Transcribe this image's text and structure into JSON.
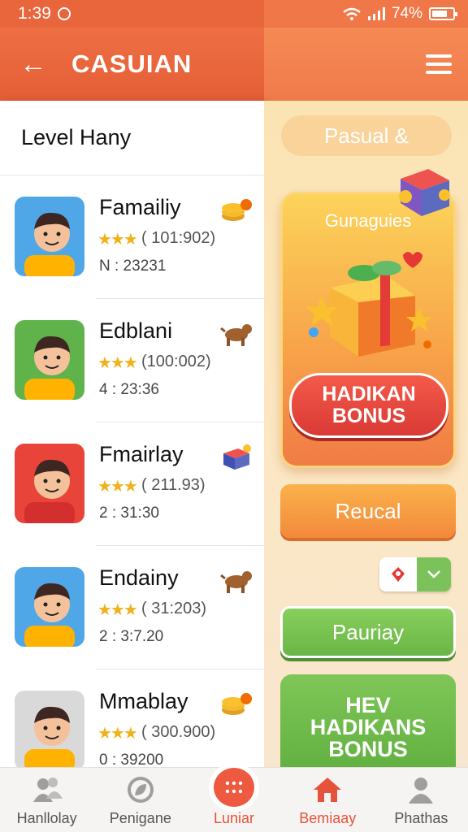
{
  "status": {
    "time": "1:39",
    "battery": "74%",
    "battery_level": 0.74
  },
  "header": {
    "title": "CASUIAN"
  },
  "left": {
    "section_title": "Level Hany",
    "games": [
      {
        "name": "Famailiy",
        "rating": "( 101:902)",
        "num": "N : 23231",
        "avatar_bg": "#4fa7e8",
        "badge": "coins-icon"
      },
      {
        "name": "Edblani",
        "rating": "(100:002)",
        "num": "4 : 23:36",
        "avatar_bg": "#5fb34a",
        "badge": "dog-icon"
      },
      {
        "name": "Fmairlay",
        "rating": "( 211.93)",
        "num": "2 : 31:30",
        "avatar_bg": "#e8443a",
        "badge": "gift-cube-icon"
      },
      {
        "name": "Endainy",
        "rating": "( 31:203)",
        "num": "2 : 3:7.20",
        "avatar_bg": "#4fa7e8",
        "badge": "dog-icon"
      },
      {
        "name": "Mmablay",
        "rating": "( 300.900)",
        "num": "0 : 39200",
        "avatar_bg": "#d9d9d9",
        "badge": "coins-icon"
      }
    ]
  },
  "right": {
    "pasual": "Pasual &",
    "card_title": "Gunaguies",
    "hadikan_button": "HADIKAN BONUS",
    "reucal_button": "Reucal",
    "pauriay_button": "Pauriay",
    "hev_button": "HEV HADIKANS BONUS"
  },
  "nav": [
    {
      "label": "Hanllolay",
      "icon": "people-icon"
    },
    {
      "label": "Penigane",
      "icon": "leaf-circle-icon"
    },
    {
      "label": "Luniar",
      "icon": "grid-dots-icon"
    },
    {
      "label": "Bemiaay",
      "icon": "home-icon"
    },
    {
      "label": "Phathas",
      "icon": "person-icon"
    }
  ],
  "colors": {
    "header": "#e9663d",
    "accent": "#ee5a40",
    "green": "#6ab646",
    "star": "#f0b21b"
  }
}
